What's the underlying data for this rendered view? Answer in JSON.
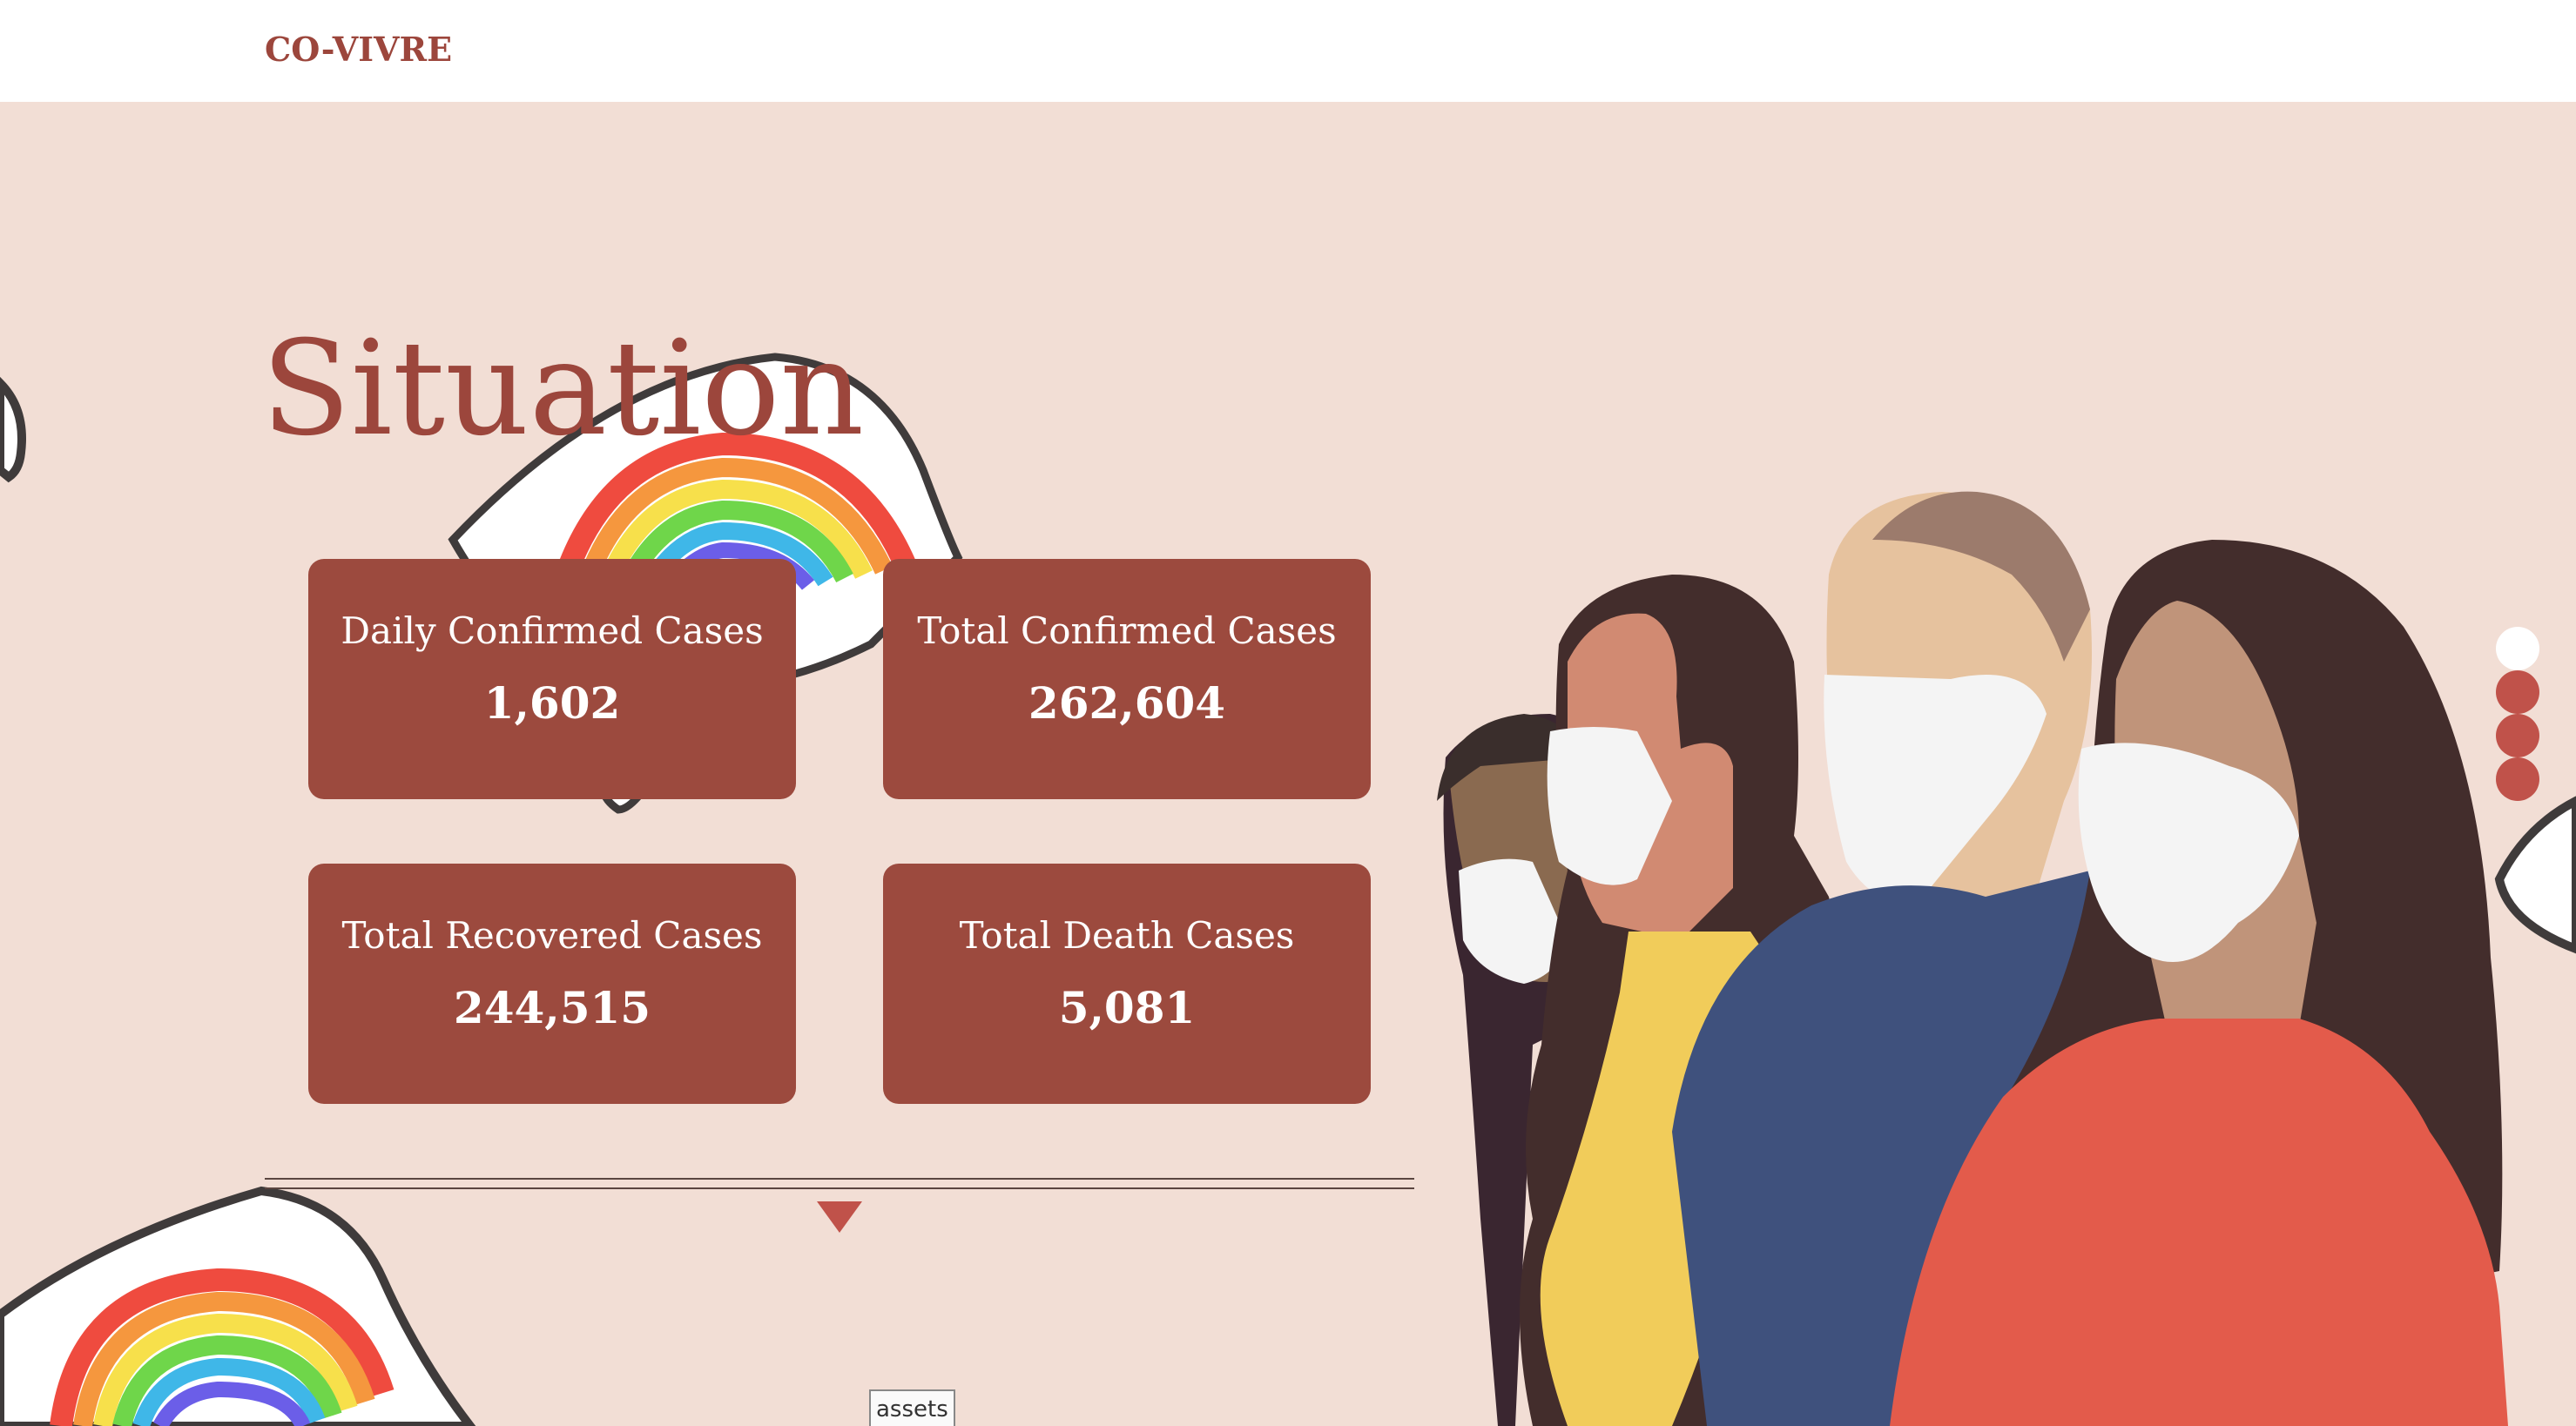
{
  "navbar": {
    "logo": "CO-VIVRE"
  },
  "section": {
    "title": "Situation"
  },
  "stats": [
    {
      "label": "Daily Confirmed Cases",
      "value": "1,602"
    },
    {
      "label": "Total Confirmed Cases",
      "value": "262,604"
    },
    {
      "label": "Total Recovered Cases",
      "value": "244,515"
    },
    {
      "label": "Total Death Cases",
      "value": "5,081"
    }
  ],
  "pagination": {
    "count": 4,
    "active_index": 0
  },
  "footer_tag": "assets",
  "colors": {
    "brand": "#9c463c",
    "card_bg": "#9c4a3e",
    "page_bg": "#f2ded5",
    "accent": "#c0524a"
  },
  "icons": {
    "scroll_down": "triangle-down-icon"
  }
}
